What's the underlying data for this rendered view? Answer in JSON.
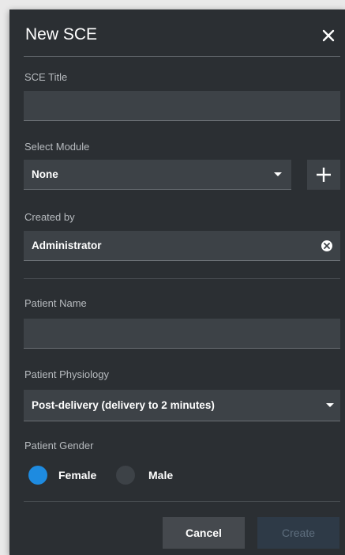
{
  "dialog": {
    "title": "New SCE",
    "close_icon": "close-icon"
  },
  "sce_title": {
    "label": "SCE Title",
    "value": ""
  },
  "module": {
    "label": "Select Module",
    "selected": "None",
    "add_icon": "plus-icon"
  },
  "created_by": {
    "label": "Created by",
    "value": "Administrator",
    "clear_icon": "clear-circle-icon"
  },
  "patient_name": {
    "label": "Patient Name",
    "value": ""
  },
  "physiology": {
    "label": "Patient Physiology",
    "selected": "Post-delivery (delivery to 2 minutes)"
  },
  "gender": {
    "label": "Patient Gender",
    "options": [
      {
        "label": "Female",
        "checked": true
      },
      {
        "label": "Male",
        "checked": false
      }
    ]
  },
  "footer": {
    "cancel_label": "Cancel",
    "create_label": "Create"
  },
  "colors": {
    "dialog_bg": "#2b2f33",
    "field_bg": "#3d4247",
    "accent": "#1e8be0",
    "label_text": "#b7bbbf"
  }
}
